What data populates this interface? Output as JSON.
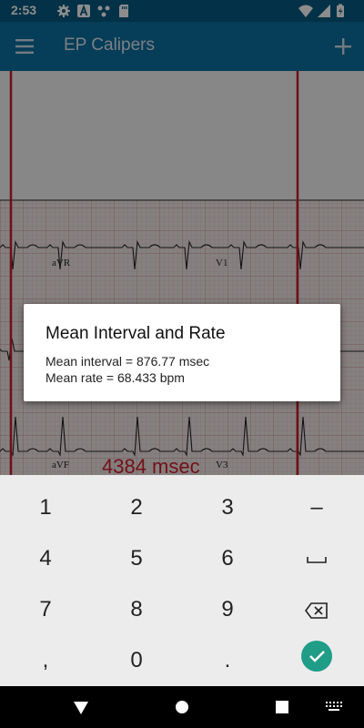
{
  "status_bar": {
    "time": "2:53",
    "icons": [
      "gear-icon",
      "a-icon",
      "cast-icon",
      "sd-card-icon",
      "wifi-icon",
      "signal-icon",
      "battery-icon"
    ]
  },
  "app_bar": {
    "title": "EP Calipers",
    "menu_icon": "menu-icon",
    "add_icon": "add-icon"
  },
  "ecg": {
    "leads": [
      "aVR",
      "V1",
      "aVF",
      "V3"
    ],
    "measurement": "4384 msec",
    "caliper_color": "#c81e28"
  },
  "dialog": {
    "title": "Mean Interval and Rate",
    "mean_interval": "Mean interval = 876.77 msec",
    "mean_rate": "Mean rate = 68.433 bpm"
  },
  "keypad": {
    "rows": [
      [
        "1",
        "2",
        "3",
        "–"
      ],
      [
        "4",
        "5",
        "6",
        "space-icon"
      ],
      [
        "7",
        "8",
        "9",
        "backspace-icon"
      ],
      [
        ",",
        "0",
        ".",
        "check-icon"
      ]
    ],
    "accent": "#1f9d87"
  },
  "nav_bar": {
    "buttons": [
      "back-icon",
      "home-icon",
      "recents-icon",
      "keyboard-icon"
    ]
  }
}
